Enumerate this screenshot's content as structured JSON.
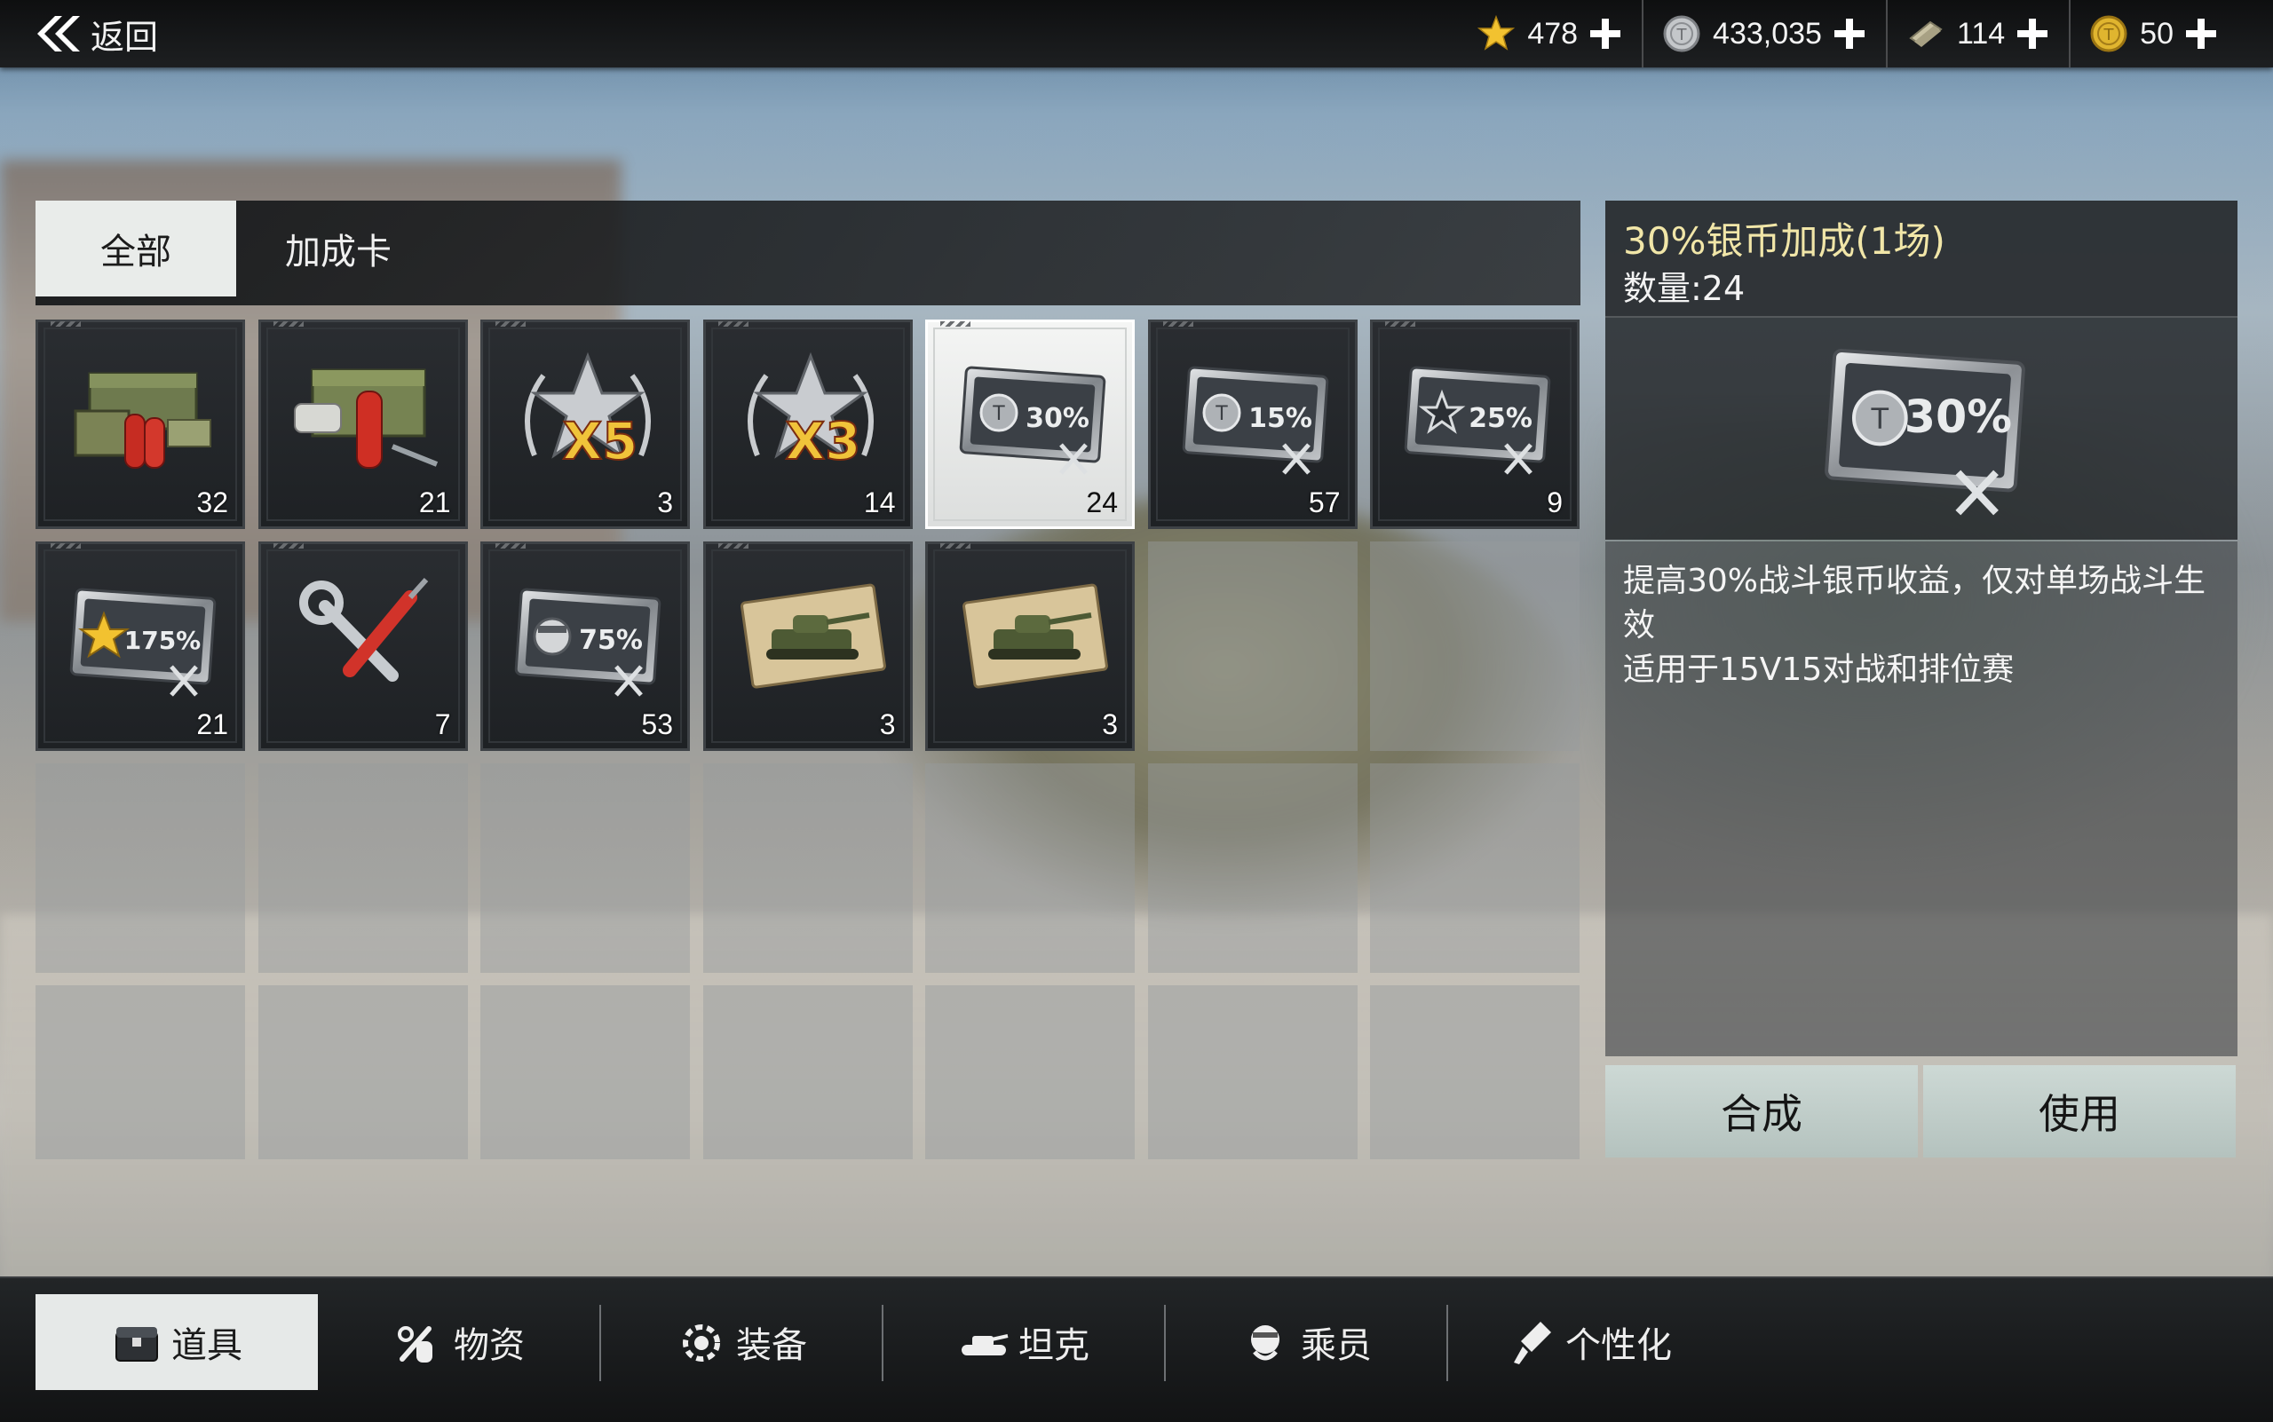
{
  "topbar": {
    "back_label": "返回",
    "currencies": [
      {
        "icon": "star-icon",
        "value": "478"
      },
      {
        "icon": "silver-coin-icon",
        "value": "433,035"
      },
      {
        "icon": "free-xp-icon",
        "value": "114"
      },
      {
        "icon": "gold-coin-icon",
        "value": "50"
      }
    ]
  },
  "tabs": [
    {
      "label": "全部",
      "active": true
    },
    {
      "label": "加成卡",
      "active": false
    }
  ],
  "inventory": [
    {
      "icon": "repair-kit-crate-icon",
      "count": "32"
    },
    {
      "icon": "medkit-extinguisher-crate-icon",
      "count": "21"
    },
    {
      "icon": "x5-star-bonus-icon",
      "count": "3",
      "text": "X5"
    },
    {
      "icon": "x3-star-bonus-icon",
      "count": "14",
      "text": "X3"
    },
    {
      "icon": "silver-bonus-card-icon",
      "count": "24",
      "text": "30%",
      "selected": true
    },
    {
      "icon": "silver-bonus-card-icon",
      "count": "57",
      "text": "15%"
    },
    {
      "icon": "star-bonus-card-icon",
      "count": "9",
      "text": "25%"
    },
    {
      "icon": "gold-star-bonus-card-icon",
      "count": "21",
      "text": "175%"
    },
    {
      "icon": "wrench-screwdriver-icon",
      "count": "7"
    },
    {
      "icon": "crew-helmet-bonus-card-icon",
      "count": "53",
      "text": "75%"
    },
    {
      "icon": "tank-ticket-icon",
      "count": "3"
    },
    {
      "icon": "tank-ticket-icon",
      "count": "3"
    }
  ],
  "detail": {
    "title": "30%银币加成(1场)",
    "quantity": "数量:24",
    "card_text": "30%",
    "description_line1": "提高30%战斗银币收益，仅对单场战斗生效",
    "description_line2": "适用于15V15对战和排位赛",
    "compose_label": "合成",
    "use_label": "使用"
  },
  "bottom_nav": [
    {
      "label": "道具",
      "icon": "item-chest-icon",
      "active": true
    },
    {
      "label": "物资",
      "icon": "supplies-icon",
      "active": false
    },
    {
      "label": "装备",
      "icon": "equipment-icon",
      "active": false
    },
    {
      "label": "坦克",
      "icon": "tank-icon",
      "active": false
    },
    {
      "label": "乘员",
      "icon": "crew-icon",
      "active": false
    },
    {
      "label": "个性化",
      "icon": "paint-brush-icon",
      "active": false
    }
  ],
  "colors": {
    "accent_title": "#f1e6a8",
    "action_button": "#c4d1cd",
    "selected_slot": "#f0f1f0"
  }
}
